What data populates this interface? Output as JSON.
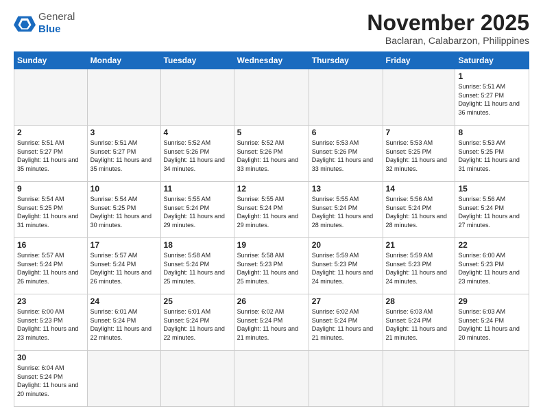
{
  "header": {
    "logo_line1": "General",
    "logo_line2": "Blue",
    "month_title": "November 2025",
    "subtitle": "Baclaran, Calabarzon, Philippines"
  },
  "days_of_week": [
    "Sunday",
    "Monday",
    "Tuesday",
    "Wednesday",
    "Thursday",
    "Friday",
    "Saturday"
  ],
  "weeks": [
    [
      {
        "day": "",
        "info": ""
      },
      {
        "day": "",
        "info": ""
      },
      {
        "day": "",
        "info": ""
      },
      {
        "day": "",
        "info": ""
      },
      {
        "day": "",
        "info": ""
      },
      {
        "day": "",
        "info": ""
      },
      {
        "day": "1",
        "info": "Sunrise: 5:51 AM\nSunset: 5:27 PM\nDaylight: 11 hours\nand 36 minutes."
      }
    ],
    [
      {
        "day": "2",
        "info": "Sunrise: 5:51 AM\nSunset: 5:27 PM\nDaylight: 11 hours\nand 35 minutes."
      },
      {
        "day": "3",
        "info": "Sunrise: 5:51 AM\nSunset: 5:27 PM\nDaylight: 11 hours\nand 35 minutes."
      },
      {
        "day": "4",
        "info": "Sunrise: 5:52 AM\nSunset: 5:26 PM\nDaylight: 11 hours\nand 34 minutes."
      },
      {
        "day": "5",
        "info": "Sunrise: 5:52 AM\nSunset: 5:26 PM\nDaylight: 11 hours\nand 33 minutes."
      },
      {
        "day": "6",
        "info": "Sunrise: 5:53 AM\nSunset: 5:26 PM\nDaylight: 11 hours\nand 33 minutes."
      },
      {
        "day": "7",
        "info": "Sunrise: 5:53 AM\nSunset: 5:25 PM\nDaylight: 11 hours\nand 32 minutes."
      },
      {
        "day": "8",
        "info": "Sunrise: 5:53 AM\nSunset: 5:25 PM\nDaylight: 11 hours\nand 31 minutes."
      }
    ],
    [
      {
        "day": "9",
        "info": "Sunrise: 5:54 AM\nSunset: 5:25 PM\nDaylight: 11 hours\nand 31 minutes."
      },
      {
        "day": "10",
        "info": "Sunrise: 5:54 AM\nSunset: 5:25 PM\nDaylight: 11 hours\nand 30 minutes."
      },
      {
        "day": "11",
        "info": "Sunrise: 5:55 AM\nSunset: 5:24 PM\nDaylight: 11 hours\nand 29 minutes."
      },
      {
        "day": "12",
        "info": "Sunrise: 5:55 AM\nSunset: 5:24 PM\nDaylight: 11 hours\nand 29 minutes."
      },
      {
        "day": "13",
        "info": "Sunrise: 5:55 AM\nSunset: 5:24 PM\nDaylight: 11 hours\nand 28 minutes."
      },
      {
        "day": "14",
        "info": "Sunrise: 5:56 AM\nSunset: 5:24 PM\nDaylight: 11 hours\nand 28 minutes."
      },
      {
        "day": "15",
        "info": "Sunrise: 5:56 AM\nSunset: 5:24 PM\nDaylight: 11 hours\nand 27 minutes."
      }
    ],
    [
      {
        "day": "16",
        "info": "Sunrise: 5:57 AM\nSunset: 5:24 PM\nDaylight: 11 hours\nand 26 minutes."
      },
      {
        "day": "17",
        "info": "Sunrise: 5:57 AM\nSunset: 5:24 PM\nDaylight: 11 hours\nand 26 minutes."
      },
      {
        "day": "18",
        "info": "Sunrise: 5:58 AM\nSunset: 5:24 PM\nDaylight: 11 hours\nand 25 minutes."
      },
      {
        "day": "19",
        "info": "Sunrise: 5:58 AM\nSunset: 5:23 PM\nDaylight: 11 hours\nand 25 minutes."
      },
      {
        "day": "20",
        "info": "Sunrise: 5:59 AM\nSunset: 5:23 PM\nDaylight: 11 hours\nand 24 minutes."
      },
      {
        "day": "21",
        "info": "Sunrise: 5:59 AM\nSunset: 5:23 PM\nDaylight: 11 hours\nand 24 minutes."
      },
      {
        "day": "22",
        "info": "Sunrise: 6:00 AM\nSunset: 5:23 PM\nDaylight: 11 hours\nand 23 minutes."
      }
    ],
    [
      {
        "day": "23",
        "info": "Sunrise: 6:00 AM\nSunset: 5:23 PM\nDaylight: 11 hours\nand 23 minutes."
      },
      {
        "day": "24",
        "info": "Sunrise: 6:01 AM\nSunset: 5:24 PM\nDaylight: 11 hours\nand 22 minutes."
      },
      {
        "day": "25",
        "info": "Sunrise: 6:01 AM\nSunset: 5:24 PM\nDaylight: 11 hours\nand 22 minutes."
      },
      {
        "day": "26",
        "info": "Sunrise: 6:02 AM\nSunset: 5:24 PM\nDaylight: 11 hours\nand 21 minutes."
      },
      {
        "day": "27",
        "info": "Sunrise: 6:02 AM\nSunset: 5:24 PM\nDaylight: 11 hours\nand 21 minutes."
      },
      {
        "day": "28",
        "info": "Sunrise: 6:03 AM\nSunset: 5:24 PM\nDaylight: 11 hours\nand 21 minutes."
      },
      {
        "day": "29",
        "info": "Sunrise: 6:03 AM\nSunset: 5:24 PM\nDaylight: 11 hours\nand 20 minutes."
      }
    ],
    [
      {
        "day": "30",
        "info": "Sunrise: 6:04 AM\nSunset: 5:24 PM\nDaylight: 11 hours\nand 20 minutes."
      },
      {
        "day": "",
        "info": ""
      },
      {
        "day": "",
        "info": ""
      },
      {
        "day": "",
        "info": ""
      },
      {
        "day": "",
        "info": ""
      },
      {
        "day": "",
        "info": ""
      },
      {
        "day": "",
        "info": ""
      }
    ]
  ]
}
